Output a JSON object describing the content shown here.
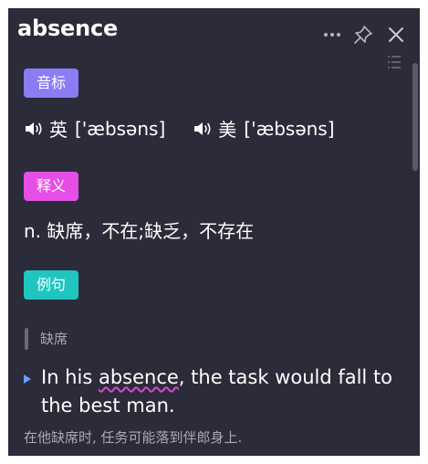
{
  "header": {
    "word": "absence",
    "more_icon": "more-horizontal-icon",
    "pin_icon": "pin-icon",
    "close_icon": "close-icon",
    "list_icon": "list-icon"
  },
  "phonetics": {
    "badge_label": "音标",
    "badge_color": "#8b7cf6",
    "items": [
      {
        "lang": "英",
        "ipa": "['æbsəns]",
        "icon": "speaker-icon"
      },
      {
        "lang": "美",
        "ipa": "['æbsəns]",
        "icon": "speaker-icon"
      }
    ]
  },
  "definition": {
    "badge_label": "释义",
    "badge_color": "#e64fe6",
    "text": "n. 缺席，不在;缺乏，不存在"
  },
  "examples": {
    "badge_label": "例句",
    "badge_color": "#1fc6c0",
    "sense_label": "缺席",
    "items": [
      {
        "en_before": "In his ",
        "en_highlight": "absence",
        "en_after": ", the task would fall to the best man.",
        "zh": "在他缺席时, 任务可能落到伴郎身上."
      }
    ]
  },
  "colors": {
    "background": "#2b2b39",
    "text": "#ffffff",
    "muted_text": "#a9a9b6",
    "highlight_underline": "#d04ad0",
    "bullet": "#6b9cff"
  }
}
